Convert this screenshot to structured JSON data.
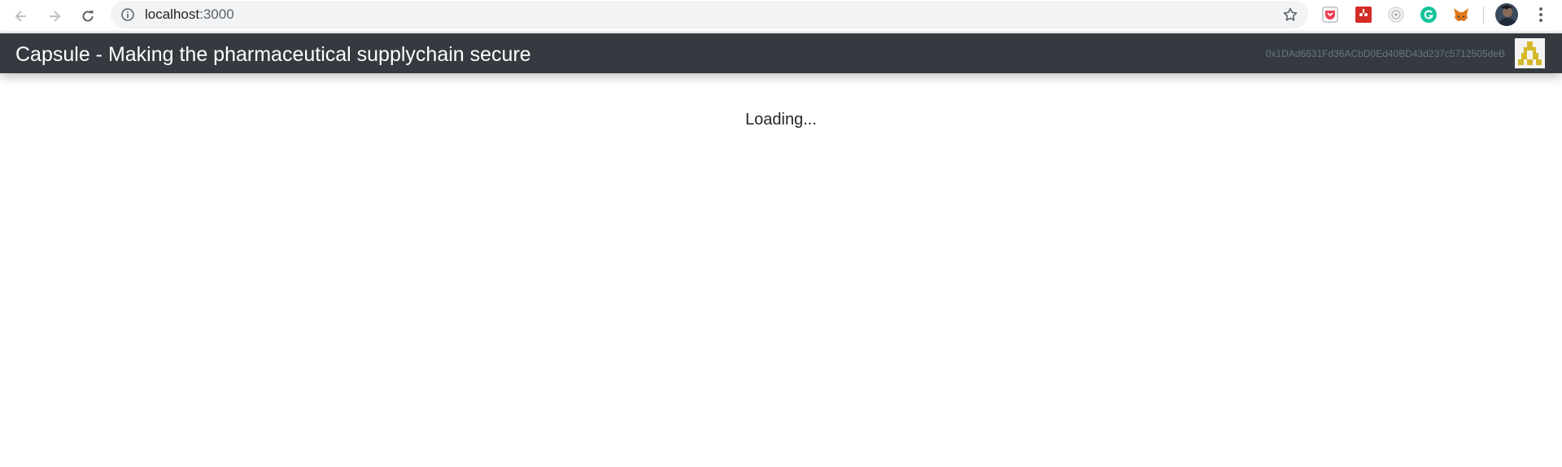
{
  "browser": {
    "url_host": "localhost",
    "url_port": ":3000",
    "extensions": [
      "pocket-icon",
      "lastpass-icon",
      "extension-icon",
      "grammarly-icon",
      "metamask-icon"
    ],
    "colors": {
      "toolbar_bg": "#ffffff",
      "omnibox_bg": "#f1f3f4",
      "grammarly": "#15c39a",
      "metamask": "#e2761b",
      "pocket": "#ef4056"
    }
  },
  "app": {
    "title": "Capsule - Making the pharmaceutical supplychain secure",
    "wallet_address": "0x1DAd6631Fd36ACbD0Ed40BD43d237c5712505deB",
    "navbar_color": "#343a40",
    "identicon_color": "#d4b82a"
  },
  "main": {
    "loading_text": "Loading..."
  }
}
